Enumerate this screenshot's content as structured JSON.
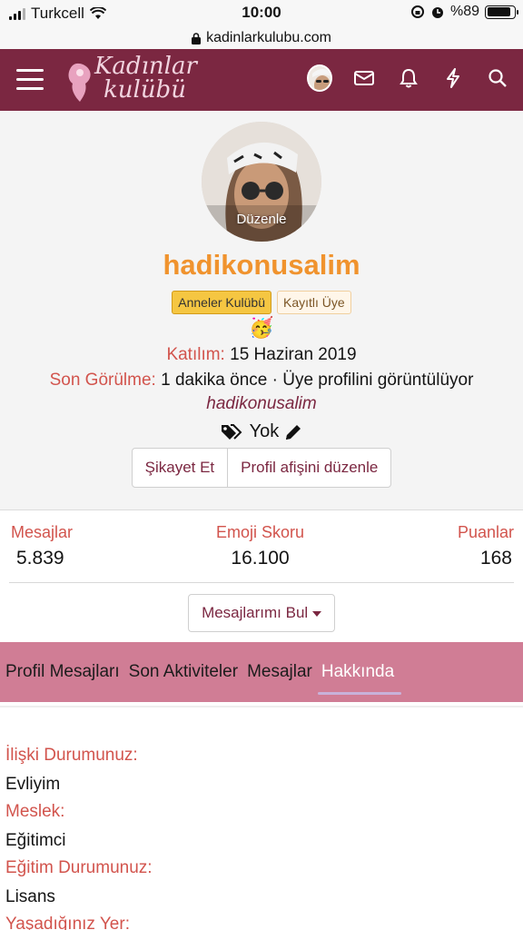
{
  "status_bar": {
    "carrier": "Turkcell",
    "time": "10:00",
    "battery": "%89"
  },
  "browser": {
    "url": "kadinlarkulubu.com"
  },
  "nav": {
    "logo_line1": "Kadınlar",
    "logo_line2": "kulübü",
    "icons": [
      "menu-icon",
      "avatar",
      "mail-icon",
      "bell-icon",
      "bolt-icon",
      "search-icon"
    ]
  },
  "profile": {
    "avatar_edit": "Düzenle",
    "username": "hadikonusalim",
    "badges": [
      "Anneler Kulübü",
      "Kayıtlı Üye"
    ],
    "emoji": "🥳",
    "joined_label": "Katılım:",
    "joined_value": "15 Haziran 2019",
    "last_seen_label": "Son Görülme:",
    "last_seen_value": "1 dakika önce · Üye profilini görüntülüyor",
    "last_seen_user": "hadikonusalim",
    "tag_value": "Yok",
    "buttons": {
      "report": "Şikayet Et",
      "edit_banner": "Profil afişini düzenle"
    }
  },
  "stats": {
    "messages_label": "Mesajlar",
    "messages_value": "5.839",
    "emoji_label": "Emoji Skoru",
    "emoji_value": "16.100",
    "points_label": "Puanlar",
    "points_value": "168"
  },
  "find_button": "Mesajlarımı Bul",
  "tabs": [
    "Profil Mesajları",
    "Son Aktiviteler",
    "Mesajlar",
    "Hakkında"
  ],
  "active_tab": "Hakkında",
  "about": [
    {
      "q": "İlişki Durumunuz:",
      "a": "Evliyim"
    },
    {
      "q": "Meslek:",
      "a": "Eğitimci"
    },
    {
      "q": "Eğitim Durumunuz:",
      "a": "Lisans"
    },
    {
      "q": "Yaşadığınız Yer:",
      "a": ""
    }
  ],
  "colors": {
    "brand": "#7b2741",
    "tabs_bg": "#d07d95",
    "username": "#f0932e",
    "label": "#d2544d"
  }
}
